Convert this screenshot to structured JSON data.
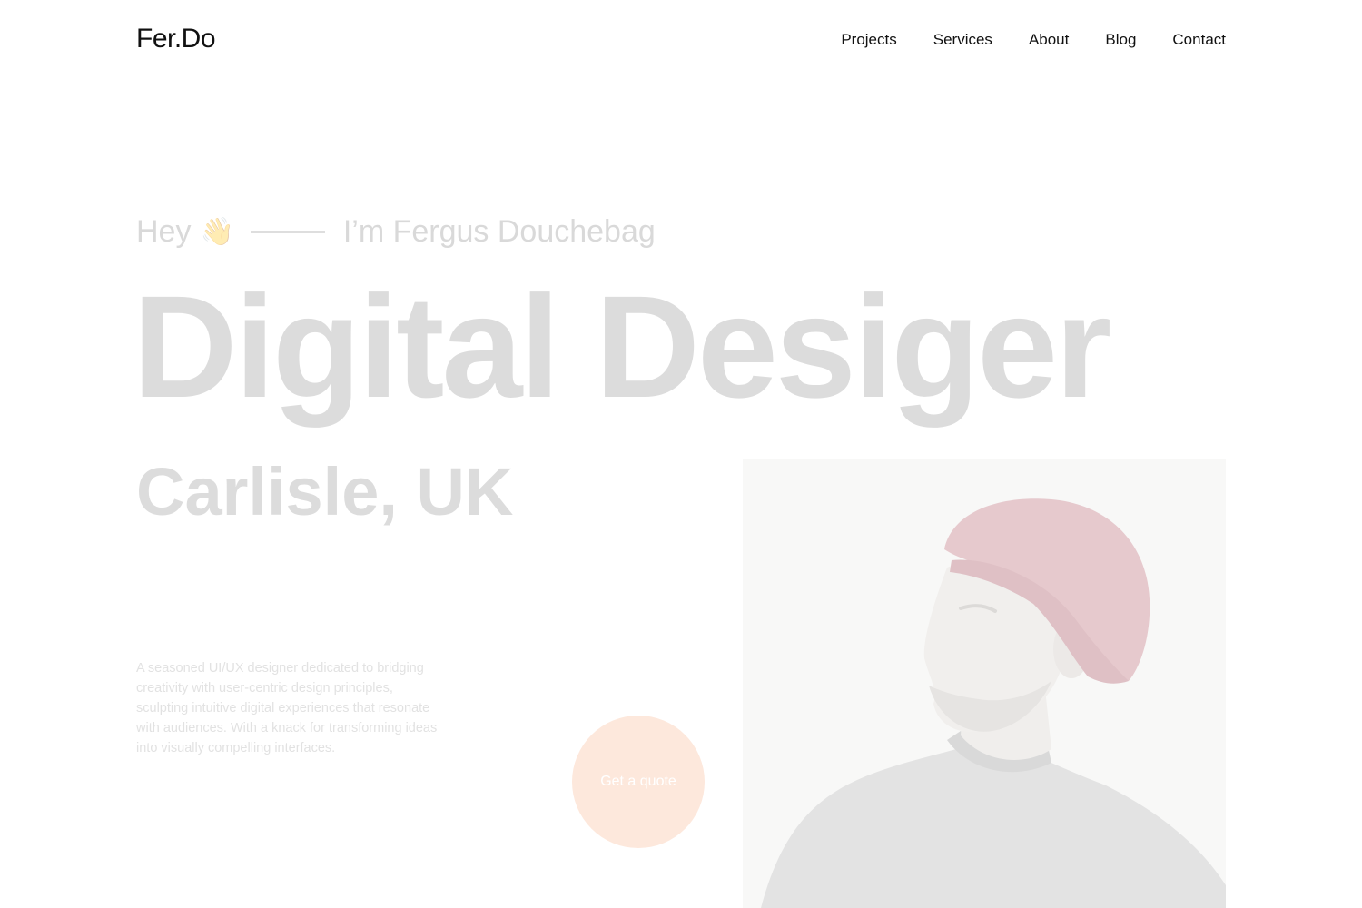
{
  "header": {
    "logo": "Fer.Do",
    "nav": [
      "Projects",
      "Services",
      "About",
      "Blog",
      "Contact"
    ]
  },
  "hero": {
    "greeting": "Hey",
    "wave_emoji": "👋",
    "intro": "I’m Fergus Douchebag",
    "headline": "Digital Desiger",
    "location": "Carlisle, UK",
    "description": "A seasoned UI/UX designer dedicated to bridging creativity with user-centric design principles, sculpting intuitive digital experiences that resonate with audiences. With a knack for transforming ideas into visually compelling interfaces.",
    "cta_label": "Get a quote"
  },
  "colors": {
    "text_dark": "#111111",
    "headline_gray": "#dcdcdc",
    "cta_bg": "#fde8dc",
    "beanie": "#e6c9cd"
  }
}
